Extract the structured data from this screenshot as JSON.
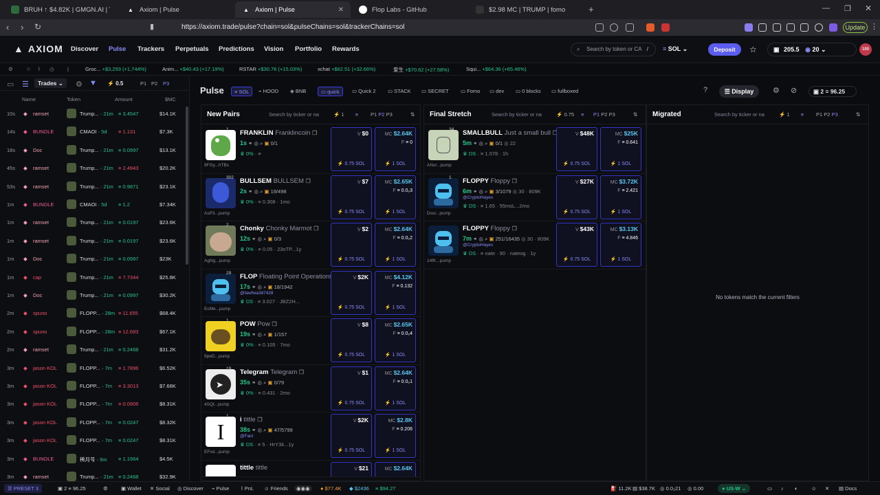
{
  "browser": {
    "tabs": [
      {
        "title": "BRUH ↑ $4.82K | GMGN.AI | The Faste",
        "active": false
      },
      {
        "title": "Axiom | Pulse",
        "active": false
      },
      {
        "title": "Axiom | Pulse",
        "active": true
      },
      {
        "title": "Flop Labs - GitHub",
        "active": false
      },
      {
        "title": "$2.98 MC | TRUMP | fomo",
        "active": false
      }
    ],
    "url": "https://axiom.trade/pulse?chain=sol&pulseChains=sol&trackerChains=sol",
    "update_label": "Update"
  },
  "nav": {
    "logo": "AXIOM",
    "items": [
      "Discover",
      "Pulse",
      "Trackers",
      "Perpetuals",
      "Predictions",
      "Vision",
      "Portfolio",
      "Rewards"
    ],
    "search_placeholder": "Search by token or CA",
    "search_shortcut": "/",
    "chain": "SOL",
    "deposit": "Deposit",
    "balance": "205.5",
    "points": "20",
    "notif_count": "100"
  },
  "ticker": [
    {
      "name": "Groc...",
      "value": "+$3,293",
      "pct": "(+1,744%)"
    },
    {
      "name": "Anim...",
      "value": "+$40.43",
      "pct": "(+17.19%)"
    },
    {
      "name": "RSTAR",
      "value": "+$30.76",
      "pct": "(+15.03%)"
    },
    {
      "name": "xchat",
      "value": "+$62.51",
      "pct": "(+32.66%)"
    },
    {
      "name": "爱生",
      "value": "+$70.62",
      "pct": "(+27.58%)"
    },
    {
      "name": "Squi...",
      "value": "+$64.36",
      "pct": "(+65.46%)"
    }
  ],
  "trades": {
    "tab": "Trades",
    "amount_filter": "0.5",
    "presets": [
      "P1",
      "P2",
      "P3"
    ],
    "columns": [
      "Name",
      "Token",
      "Amount",
      "$MC"
    ],
    "rows": [
      {
        "age": "10s",
        "name": "ramset",
        "side": "buy",
        "token": "Trump...",
        "tage": "21m",
        "amount": "3.4547",
        "mc": "$14.1K"
      },
      {
        "age": "14s",
        "name": "BUNDLE",
        "side": "sell",
        "token": "CMAOI",
        "tage": "5d",
        "amount": "1.131",
        "mc": "$7.3K"
      },
      {
        "age": "18s",
        "name": "Doc",
        "side": "buy",
        "token": "Trump...",
        "tage": "21m",
        "amount": "0.0997",
        "mc": "$13.1K"
      },
      {
        "age": "45s",
        "name": "ramset",
        "side": "sell",
        "token": "Trump...",
        "tage": "21m",
        "amount": "2.4943",
        "mc": "$20.2K"
      },
      {
        "age": "53s",
        "name": "ramset",
        "side": "buy",
        "token": "Trump...",
        "tage": "21m",
        "amount": "0.9871",
        "mc": "$23.1K"
      },
      {
        "age": "1m",
        "name": "BUNDLE",
        "side": "buy",
        "token": "CMAOI",
        "tage": "5d",
        "amount": "1.2",
        "mc": "$7.34K"
      },
      {
        "age": "1m",
        "name": "ramset",
        "side": "buy",
        "token": "Trump...",
        "tage": "21m",
        "amount": "0.0197",
        "mc": "$23.6K"
      },
      {
        "age": "1m",
        "name": "ramset",
        "side": "buy",
        "token": "Trump...",
        "tage": "21m",
        "amount": "0.0197",
        "mc": "$23.6K"
      },
      {
        "age": "1m",
        "name": "Doc",
        "side": "buy",
        "token": "Trump...",
        "tage": "21m",
        "amount": "0.0997",
        "mc": "$23K"
      },
      {
        "age": "1m",
        "name": "cap",
        "side": "sell",
        "token": "Trump...",
        "tage": "21m",
        "amount": "7.7344",
        "mc": "$25.8K"
      },
      {
        "age": "1m",
        "name": "Doc",
        "side": "buy",
        "token": "Trump...",
        "tage": "21m",
        "amount": "0.0997",
        "mc": "$30.2K"
      },
      {
        "age": "2m",
        "name": "spuno",
        "side": "sell",
        "token": "FLOPP...",
        "tage": "28m",
        "amount": "11.655",
        "mc": "$68.4K"
      },
      {
        "age": "2m",
        "name": "spuno",
        "side": "sell",
        "token": "FLOPP...",
        "tage": "28m",
        "amount": "12.683",
        "mc": "$67.1K"
      },
      {
        "age": "2m",
        "name": "ramset",
        "side": "buy",
        "token": "Trump...",
        "tage": "21m",
        "amount": "0.2468",
        "mc": "$31.2K"
      },
      {
        "age": "3m",
        "name": "jason KOL",
        "side": "sell",
        "token": "FLOPP...",
        "tage": "7m",
        "amount": "1.7896",
        "mc": "$6.52K"
      },
      {
        "age": "3m",
        "name": "jason KOL",
        "side": "sell",
        "token": "FLOPP...",
        "tage": "7m",
        "amount": "3.3013",
        "mc": "$7.66K"
      },
      {
        "age": "3m",
        "name": "jason KOL",
        "side": "sell",
        "token": "FLOPP...",
        "tage": "7m",
        "amount": "0.0906",
        "mc": "$8.31K"
      },
      {
        "age": "3m",
        "name": "jason KOL",
        "side": "buy",
        "token": "FLOPP...",
        "tage": "7m",
        "amount": "0.0247",
        "mc": "$8.32K"
      },
      {
        "age": "3m",
        "name": "jason KOL",
        "side": "buy",
        "token": "FLOPP...",
        "tage": "7m",
        "amount": "0.0247",
        "mc": "$8.31K"
      },
      {
        "age": "3m",
        "name": "BUNDLE",
        "side": "buy",
        "token": "稀月号",
        "tage": "9m",
        "amount": "1.1964",
        "mc": "$4.5K"
      },
      {
        "age": "3m",
        "name": "ramset",
        "side": "buy",
        "token": "Trump...",
        "tage": "21m",
        "amount": "0.2468",
        "mc": "$32.9K"
      }
    ]
  },
  "pulse": {
    "title": "Pulse",
    "chains": [
      "SOL",
      "HOOD",
      "BNB"
    ],
    "filters": [
      "quick",
      "Quick 2",
      "STACK",
      "SECRET",
      "Fomo",
      "dev",
      "0 blocks",
      "fullboxed"
    ],
    "display": "Display",
    "preset_count": "2",
    "preset_value": "96.25"
  },
  "columns": {
    "new_pairs": {
      "title": "New Pairs",
      "search": "Search by ticker or na",
      "count": "1",
      "presets": [
        "P1",
        "P2",
        "P3"
      ],
      "cards": [
        {
          "ticker": "FRANKLIN",
          "name": "Franklincoin",
          "age": "1s",
          "addr": "9FGy...hTBs",
          "holders": "0/1",
          "pct": "0%",
          "extra": "",
          "v": "$0",
          "mc": "$2.64K",
          "f": "0",
          "count": "1",
          "img": "frog"
        },
        {
          "ticker": "BULLSEM",
          "name": "BULLSEM",
          "age": "2s",
          "addr": "AsP3...pump",
          "holders": "19/498",
          "pct": "0%",
          "extra": "0.308 · 1mo",
          "v": "$7",
          "mc": "$2.65K",
          "f": "0.0₂3",
          "count": "302",
          "img": "anime"
        },
        {
          "ticker": "Chonky",
          "name": "Chonky Marmot",
          "age": "12s",
          "addr": "AgNg...pump",
          "holders": "0/3",
          "pct": "0%",
          "extra": "0.05 · 23oTP...1y",
          "v": "$2",
          "mc": "$2.64K",
          "f": "0.0₂2",
          "count": "2",
          "img": "marmot"
        },
        {
          "ticker": "FLOP",
          "name": "Floating Point Operations",
          "age": "17s",
          "addr": "EcMe...pump",
          "holders": "18/1942",
          "pct": "DS",
          "extra": "3.027 · JBZ2H...",
          "v": "$2K",
          "mc": "$4.12K",
          "f": "0.132",
          "count": "29",
          "img": "robot",
          "handle": "@fawfwa387428"
        },
        {
          "ticker": "POW",
          "name": "Pow",
          "age": "19s",
          "addr": "9peD...pump",
          "holders": "1/157",
          "pct": "0%",
          "extra": "0.105 · 7mo",
          "v": "$8",
          "mc": "$2.65K",
          "f": "0.0₂4",
          "count": "1",
          "img": "pow"
        },
        {
          "ticker": "Telegram",
          "name": "Telegram",
          "age": "35s",
          "addr": "4SQt...pump",
          "holders": "0/79",
          "pct": "0%",
          "extra": "0.431 · 2mo",
          "v": "$1",
          "mc": "$2.64K",
          "f": "0.0₂1",
          "count": "19",
          "img": "telegram"
        },
        {
          "ticker": "i",
          "name": "tittle",
          "age": "38s",
          "addr": "EFxd...pump",
          "holders": "47/5799",
          "pct": "DS",
          "extra": "5 · HrY3k...1y",
          "v": "$2K",
          "mc": "$2.8K",
          "f": "0.206",
          "count": "1",
          "img": "i",
          "handle": "@Fact"
        }
      ],
      "partial": {
        "ticker": "tittle",
        "name": "tittle",
        "v": "$21",
        "mc": "$2.64K"
      }
    },
    "final_stretch": {
      "title": "Final Stretch",
      "search": "Search by ticker or na",
      "count": "0.75",
      "presets": [
        "P1",
        "P2",
        "P3"
      ],
      "cards": [
        {
          "ticker": "SMALLBULL",
          "name": "Just a small bull",
          "age": "5m",
          "addr": "ANvr...pump",
          "holders": "0/1",
          "pct": "DS",
          "extra": "1.078 · 1h",
          "v": "$48K",
          "mc": "$25K",
          "f": "0.641",
          "count": "34",
          "img": "sketch",
          "stat2": "22"
        },
        {
          "ticker": "FLOPPY",
          "name": "Floppy",
          "age": "6m",
          "addr": "Dssr...pump",
          "holders": "3/1079",
          "pct": "DS",
          "extra": "1.65 · 55msL...2mo",
          "v": "$27K",
          "mc": "$3.72K",
          "f": "2.421",
          "count": "1",
          "img": "robot",
          "handle": "@CryptoHayes",
          "stat2": "30 · 809K"
        },
        {
          "ticker": "FLOPPY",
          "name": "Floppy",
          "age": "7m",
          "addr": "14fK...pump",
          "holders": "251/16435",
          "pct": "DS",
          "extra": "nate · 90 · nateog · 1y",
          "v": "$43K",
          "mc": "$3.13K",
          "f": "4.846",
          "count": "",
          "img": "robot",
          "handle": "@CryptoHayes",
          "stat2": "30 · 809K"
        }
      ]
    },
    "migrated": {
      "title": "Migrated",
      "search": "Search by ticker or na",
      "count": "1",
      "presets": [
        "P1",
        "P2",
        "P3"
      ],
      "empty": "No tokens match the current filters"
    }
  },
  "sol_label": "0.75 SOL",
  "sol_label_b": "1 SOL",
  "footer": {
    "preset": "PRESET 3",
    "count": "2",
    "value": "96.25",
    "items": [
      "Wallet",
      "Social",
      "Discover",
      "Pulse",
      "PnL",
      "Friends"
    ],
    "stats": [
      "$77.4K",
      "$2436",
      "$94.27"
    ],
    "right": [
      "11.2K",
      "$38.7K",
      "0.0₂21",
      "0.00"
    ],
    "region": "US-W",
    "docs": "Docs"
  },
  "colors": {
    "accent": "#5b5cf0",
    "green": "#25c58a",
    "red": "#ef4f6a",
    "blue": "#5bc7f0"
  }
}
